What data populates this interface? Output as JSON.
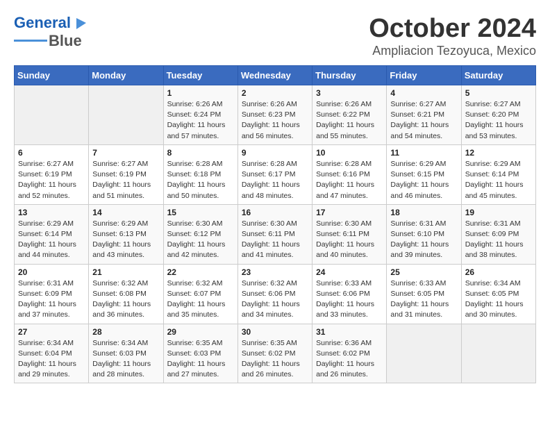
{
  "header": {
    "logo_line1": "General",
    "logo_line2": "Blue",
    "month_year": "October 2024",
    "location": "Ampliacion Tezoyuca, Mexico"
  },
  "weekdays": [
    "Sunday",
    "Monday",
    "Tuesday",
    "Wednesday",
    "Thursday",
    "Friday",
    "Saturday"
  ],
  "weeks": [
    [
      {
        "day": "",
        "info": ""
      },
      {
        "day": "",
        "info": ""
      },
      {
        "day": "1",
        "info": "Sunrise: 6:26 AM\nSunset: 6:24 PM\nDaylight: 11 hours and 57 minutes."
      },
      {
        "day": "2",
        "info": "Sunrise: 6:26 AM\nSunset: 6:23 PM\nDaylight: 11 hours and 56 minutes."
      },
      {
        "day": "3",
        "info": "Sunrise: 6:26 AM\nSunset: 6:22 PM\nDaylight: 11 hours and 55 minutes."
      },
      {
        "day": "4",
        "info": "Sunrise: 6:27 AM\nSunset: 6:21 PM\nDaylight: 11 hours and 54 minutes."
      },
      {
        "day": "5",
        "info": "Sunrise: 6:27 AM\nSunset: 6:20 PM\nDaylight: 11 hours and 53 minutes."
      }
    ],
    [
      {
        "day": "6",
        "info": "Sunrise: 6:27 AM\nSunset: 6:19 PM\nDaylight: 11 hours and 52 minutes."
      },
      {
        "day": "7",
        "info": "Sunrise: 6:27 AM\nSunset: 6:19 PM\nDaylight: 11 hours and 51 minutes."
      },
      {
        "day": "8",
        "info": "Sunrise: 6:28 AM\nSunset: 6:18 PM\nDaylight: 11 hours and 50 minutes."
      },
      {
        "day": "9",
        "info": "Sunrise: 6:28 AM\nSunset: 6:17 PM\nDaylight: 11 hours and 48 minutes."
      },
      {
        "day": "10",
        "info": "Sunrise: 6:28 AM\nSunset: 6:16 PM\nDaylight: 11 hours and 47 minutes."
      },
      {
        "day": "11",
        "info": "Sunrise: 6:29 AM\nSunset: 6:15 PM\nDaylight: 11 hours and 46 minutes."
      },
      {
        "day": "12",
        "info": "Sunrise: 6:29 AM\nSunset: 6:14 PM\nDaylight: 11 hours and 45 minutes."
      }
    ],
    [
      {
        "day": "13",
        "info": "Sunrise: 6:29 AM\nSunset: 6:14 PM\nDaylight: 11 hours and 44 minutes."
      },
      {
        "day": "14",
        "info": "Sunrise: 6:29 AM\nSunset: 6:13 PM\nDaylight: 11 hours and 43 minutes."
      },
      {
        "day": "15",
        "info": "Sunrise: 6:30 AM\nSunset: 6:12 PM\nDaylight: 11 hours and 42 minutes."
      },
      {
        "day": "16",
        "info": "Sunrise: 6:30 AM\nSunset: 6:11 PM\nDaylight: 11 hours and 41 minutes."
      },
      {
        "day": "17",
        "info": "Sunrise: 6:30 AM\nSunset: 6:11 PM\nDaylight: 11 hours and 40 minutes."
      },
      {
        "day": "18",
        "info": "Sunrise: 6:31 AM\nSunset: 6:10 PM\nDaylight: 11 hours and 39 minutes."
      },
      {
        "day": "19",
        "info": "Sunrise: 6:31 AM\nSunset: 6:09 PM\nDaylight: 11 hours and 38 minutes."
      }
    ],
    [
      {
        "day": "20",
        "info": "Sunrise: 6:31 AM\nSunset: 6:09 PM\nDaylight: 11 hours and 37 minutes."
      },
      {
        "day": "21",
        "info": "Sunrise: 6:32 AM\nSunset: 6:08 PM\nDaylight: 11 hours and 36 minutes."
      },
      {
        "day": "22",
        "info": "Sunrise: 6:32 AM\nSunset: 6:07 PM\nDaylight: 11 hours and 35 minutes."
      },
      {
        "day": "23",
        "info": "Sunrise: 6:32 AM\nSunset: 6:06 PM\nDaylight: 11 hours and 34 minutes."
      },
      {
        "day": "24",
        "info": "Sunrise: 6:33 AM\nSunset: 6:06 PM\nDaylight: 11 hours and 33 minutes."
      },
      {
        "day": "25",
        "info": "Sunrise: 6:33 AM\nSunset: 6:05 PM\nDaylight: 11 hours and 31 minutes."
      },
      {
        "day": "26",
        "info": "Sunrise: 6:34 AM\nSunset: 6:05 PM\nDaylight: 11 hours and 30 minutes."
      }
    ],
    [
      {
        "day": "27",
        "info": "Sunrise: 6:34 AM\nSunset: 6:04 PM\nDaylight: 11 hours and 29 minutes."
      },
      {
        "day": "28",
        "info": "Sunrise: 6:34 AM\nSunset: 6:03 PM\nDaylight: 11 hours and 28 minutes."
      },
      {
        "day": "29",
        "info": "Sunrise: 6:35 AM\nSunset: 6:03 PM\nDaylight: 11 hours and 27 minutes."
      },
      {
        "day": "30",
        "info": "Sunrise: 6:35 AM\nSunset: 6:02 PM\nDaylight: 11 hours and 26 minutes."
      },
      {
        "day": "31",
        "info": "Sunrise: 6:36 AM\nSunset: 6:02 PM\nDaylight: 11 hours and 26 minutes."
      },
      {
        "day": "",
        "info": ""
      },
      {
        "day": "",
        "info": ""
      }
    ]
  ]
}
